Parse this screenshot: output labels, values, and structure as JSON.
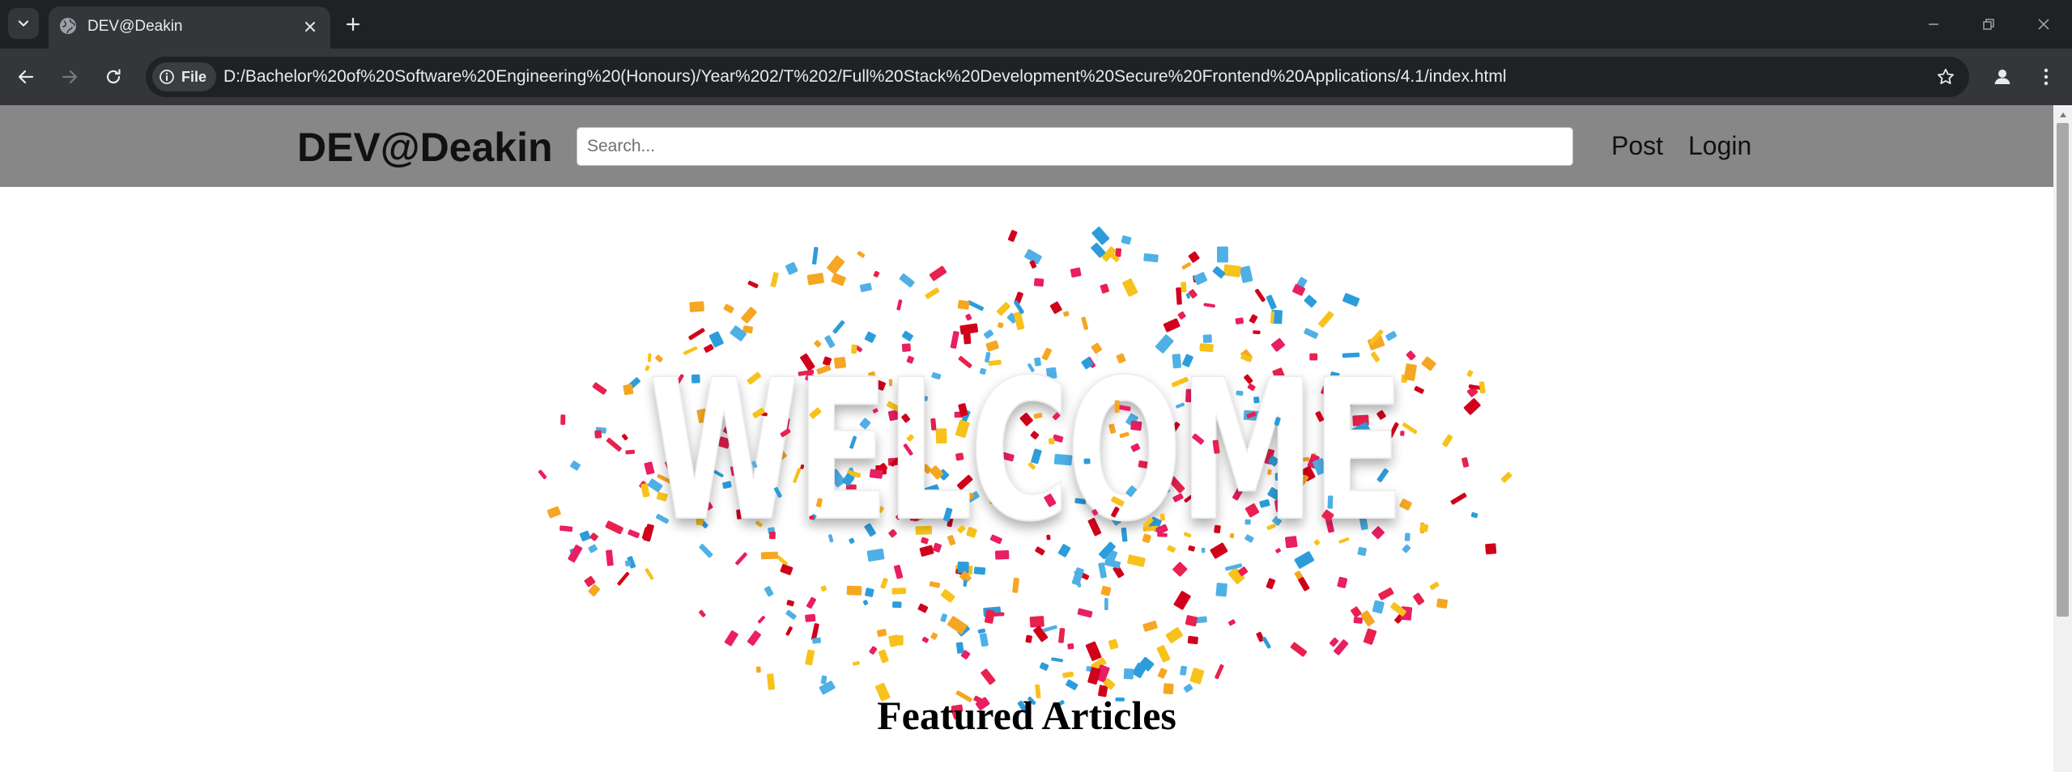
{
  "browser": {
    "tab": {
      "title": "DEV@Deakin"
    },
    "address_bar": {
      "chip_label": "File",
      "url": "D:/Bachelor%20of%20Software%20Engineering%20(Honours)/Year%202/T%202/Full%20Stack%20Development%20Secure%20Frontend%20Applications/4.1/index.html"
    },
    "icons": {
      "tab_search": "chevron-down-icon",
      "favicon": "globe-icon",
      "tab_close": "close-icon",
      "new_tab": "plus-icon",
      "minimize": "minimize-icon",
      "restore": "restore-icon",
      "close_window": "close-icon",
      "back": "back-arrow-icon",
      "forward": "forward-arrow-icon",
      "reload": "reload-icon",
      "site_info": "info-icon",
      "bookmark": "star-icon",
      "profile": "profile-icon",
      "menu": "kebab-menu-icon"
    },
    "colors": {
      "tabstrip": "#202124",
      "toolbar": "#35363a",
      "omnibox": "#202124",
      "text": "#e8eaed"
    }
  },
  "site": {
    "brand": "DEV@Deakin",
    "search": {
      "placeholder": "Search...",
      "value": ""
    },
    "nav": {
      "post": "Post",
      "login": "Login"
    },
    "hero": {
      "text": "WELCOME"
    },
    "featured_title": "Featured Articles",
    "colors": {
      "header_bg": "#878787",
      "confetti": [
        "#e8214f",
        "#f5a623",
        "#2d9cdb",
        "#d0021b",
        "#f8c21c",
        "#4fb0e6",
        "#e91e63"
      ]
    }
  }
}
